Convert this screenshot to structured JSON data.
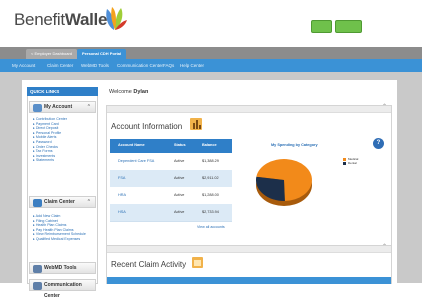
{
  "header": {
    "brand_light": "Benefit",
    "brand_bold": "Wallet",
    "brand_mark": "multicolor-leaf-logo-icon"
  },
  "tabs": [
    {
      "label": "< Employer Dashboard"
    },
    {
      "label": "Personal CDH Portal"
    }
  ],
  "nav": [
    {
      "label": "My Account"
    },
    {
      "label": "Claim Center"
    },
    {
      "label": "WebMD Tools"
    },
    {
      "label": "Communication Center"
    },
    {
      "label": "FAQs"
    },
    {
      "label": "Help Center"
    }
  ],
  "sidebar": {
    "quick_links": "QUICK LINKS",
    "sections": [
      {
        "title": "My Account",
        "icon": "person-icon",
        "links": [
          "Contribution Center",
          "Payment Card",
          "Direct Deposit",
          "Personal Profile",
          "Mobile Alerts",
          "Password",
          "Order Checks",
          "Tax Forms",
          "Investments",
          "Statements"
        ]
      },
      {
        "title": "Claim Center",
        "icon": "card-icon",
        "links": [
          "Add New Claim",
          "Filing Cabinet",
          "Health Plan Claims",
          "Pay Health Plan Claims",
          "View Reimbursement Schedule",
          "Qualified Medical Expenses"
        ]
      },
      {
        "title": "WebMD Tools",
        "icon": "stethoscope-icon",
        "links": []
      },
      {
        "title": "Communication Center",
        "icon": "envelope-icon",
        "links": []
      }
    ]
  },
  "main": {
    "welcome_prefix": "Welcome",
    "welcome_name": "Dylan",
    "account_info": {
      "title": "Account Information",
      "columns": [
        "Account Name",
        "Status",
        "Balance"
      ],
      "rows": [
        {
          "name": "Dependent Care FSA",
          "status": "Active",
          "balance": "$1,388.29"
        },
        {
          "name": "FSA",
          "status": "Active",
          "balance": "$2,911.02"
        },
        {
          "name": "HRA",
          "status": "Active",
          "balance": "$1,288.00"
        },
        {
          "name": "HSA",
          "status": "Active",
          "balance": "$2,733.94"
        }
      ],
      "view_all": "View all accounts"
    },
    "spending": {
      "title": "My Spending by Category",
      "help": "?",
      "legend": [
        {
          "label": "Medical",
          "color": "#f28a1a"
        },
        {
          "label": "Dental",
          "color": "#1c2f4a"
        }
      ],
      "medical_fraction": 0.72
    },
    "claims": {
      "title": "Recent Claim Activity"
    }
  },
  "colors": {
    "nav": "#3b92d6",
    "table_header": "#2f7fc8",
    "accent_green": "#6fc14b"
  }
}
